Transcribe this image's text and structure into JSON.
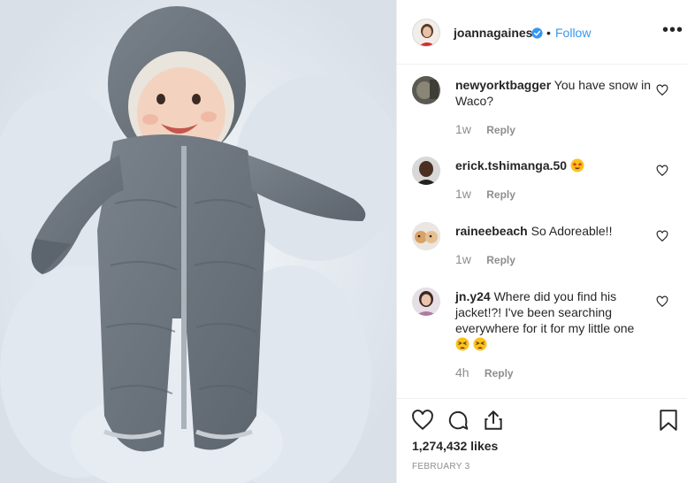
{
  "post": {
    "image_alt": "Baby in a grey puffer snowsuit lying in a snow angel"
  },
  "header": {
    "username": "joannagaines",
    "separator": "•",
    "follow_label": "Follow",
    "more_label": "•••"
  },
  "comments": [
    {
      "username": "newyorktbagger",
      "text": "You have snow in Waco?",
      "age": "1w",
      "reply_label": "Reply"
    },
    {
      "username": "erick.tshimanga.50",
      "text": "",
      "emoji": "star-struck",
      "age": "1w",
      "reply_label": "Reply"
    },
    {
      "username": "raineebeach",
      "text": "So Adoreable!!",
      "age": "1w",
      "reply_label": "Reply"
    },
    {
      "username": "jn.y24",
      "text": "Where did you find his jacket!?! I've been searching everywhere for it for my little one",
      "emoji": "tired-faces",
      "age": "4h",
      "reply_label": "Reply"
    }
  ],
  "footer": {
    "likes": "1,274,432 likes",
    "date": "FEBRUARY 3"
  },
  "colors": {
    "link": "#3897f0",
    "verified": "#3897f0",
    "muted": "#8e8e8e",
    "divider": "#efefef",
    "snowsuit": "#6b737c"
  },
  "icons": [
    "verified-badge-icon",
    "more-options-icon",
    "heart-icon",
    "comment-icon",
    "share-icon",
    "bookmark-icon"
  ]
}
